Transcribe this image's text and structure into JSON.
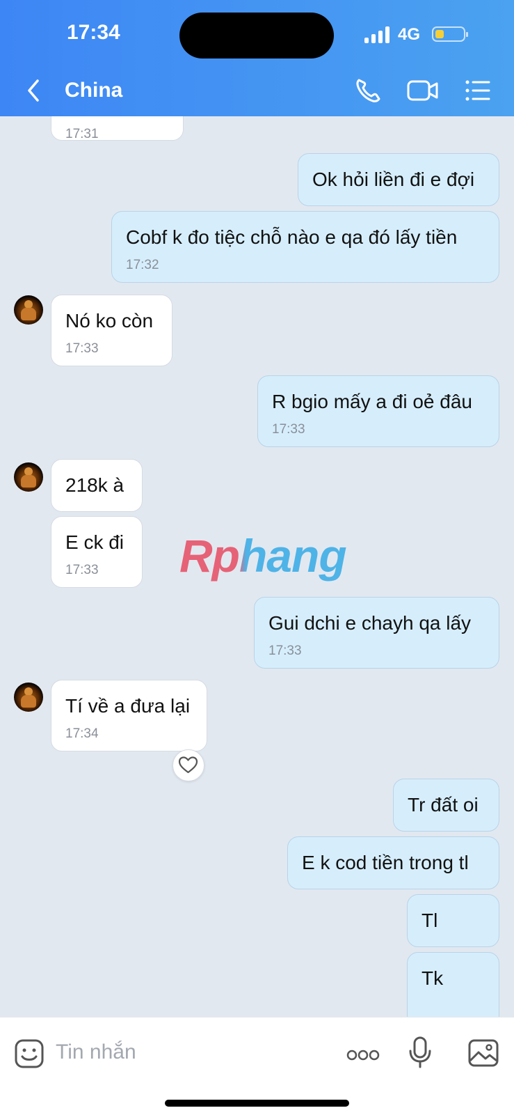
{
  "status_bar": {
    "time": "17:34",
    "network": "4G"
  },
  "header": {
    "title": "China"
  },
  "messages": [
    {
      "text": "",
      "time": "17:31"
    },
    {
      "text": "Ok hỏi liền đi e đợi",
      "time": ""
    },
    {
      "text": "Cobf k đo tiệc chỗ nào e qa đó lấy tiền",
      "time": "17:32"
    },
    {
      "text": "Nó ko còn",
      "time": "17:33"
    },
    {
      "text": "R bgio mấy a đi oẻ đâu",
      "time": "17:33"
    },
    {
      "text": "218k à",
      "time": ""
    },
    {
      "text": "E ck đi",
      "time": "17:33"
    },
    {
      "text": "Gui dchi e chayh qa lấy",
      "time": "17:33"
    },
    {
      "text": "Tí về a đưa lại",
      "time": "17:34"
    },
    {
      "text": "Tr đất oi",
      "time": ""
    },
    {
      "text": "E k cod tiền trong tl",
      "time": ""
    },
    {
      "text": "Tl",
      "time": ""
    },
    {
      "text": "Tk",
      "time": ""
    }
  ],
  "watermark": "Rphang",
  "input": {
    "placeholder": "Tin nhắn"
  },
  "icons": {
    "back": "chevron-left-icon",
    "call": "phone-icon",
    "video": "video-camera-icon",
    "menu": "list-menu-icon",
    "sticker": "emoji-sticker-icon",
    "more": "more-dots-icon",
    "mic": "microphone-icon",
    "image": "image-icon",
    "reaction": "heart-icon"
  },
  "colors": {
    "header_gradient_start": "#3d86f5",
    "header_gradient_end": "#4ba2f0",
    "outgoing_bubble": "#d6eefc",
    "incoming_bubble": "#ffffff",
    "chat_background": "#e2e8f0"
  }
}
